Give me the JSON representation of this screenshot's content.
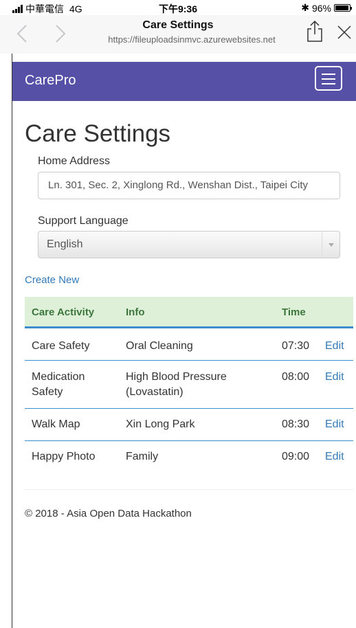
{
  "status": {
    "carrier": "中華電信",
    "network": "4G",
    "time": "下午9:36",
    "bluetooth": "✱",
    "battery_percent": "96%",
    "battery_level": 0.96
  },
  "browser": {
    "title": "Care Settings",
    "url": "https://fileuploadsinmvc.azurewebsites.net",
    "back_icon": "chevron-left-icon",
    "forward_icon": "chevron-right-icon",
    "share_icon": "share-icon",
    "close_icon": "close-icon"
  },
  "navbar": {
    "brand": "CarePro",
    "color": "#5650a7",
    "menu_icon": "hamburger-icon"
  },
  "page": {
    "title": "Care Settings",
    "home_address_label": "Home Address",
    "home_address_value": "Ln. 301, Sec. 2, Xinglong Rd., Wenshan Dist., Taipei City",
    "language_label": "Support Language",
    "language_value": "English",
    "create_new": "Create New"
  },
  "table": {
    "headers": [
      "Care Activity",
      "Info",
      "Time"
    ],
    "rows": [
      {
        "activity": "Care Safety",
        "info": "Oral Cleaning",
        "time": "07:30",
        "action": "Edit"
      },
      {
        "activity": "Medication Safety",
        "info": "High Blood Pressure (Lovastatin)",
        "time": "08:00",
        "action": "Edit"
      },
      {
        "activity": "Walk Map",
        "info": "Xin Long Park",
        "time": "08:30",
        "action": "Edit"
      },
      {
        "activity": "Happy Photo",
        "info": "Family",
        "time": "09:00",
        "action": "Edit"
      }
    ]
  },
  "footer": {
    "text": "© 2018 - Asia Open Data Hackathon"
  }
}
